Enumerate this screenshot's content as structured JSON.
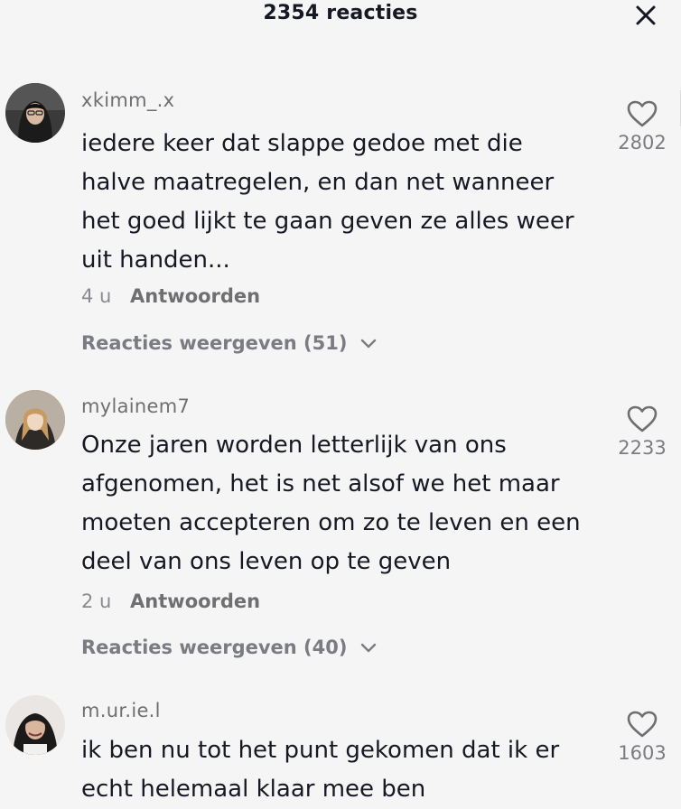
{
  "header": {
    "title": "2354 reacties",
    "close_icon": "close-icon"
  },
  "colors": {
    "background": "#f5f5f5",
    "text_primary": "#161823",
    "text_secondary": "#8a8b91"
  },
  "comments": [
    {
      "username": "xkimm_.x",
      "text": "iedere keer dat slappe gedoe met die halve maatregelen, en dan net wanneer het goed lijkt te gaan geven ze alles weer uit handen...",
      "time": "4 u",
      "reply_label": "Antwoorden",
      "view_replies": "Reacties weergeven (51)",
      "likes": "2802",
      "avatar_icon": "avatar"
    },
    {
      "username": "mylainem7",
      "text": "Onze jaren worden letterlijk van ons afgenomen, het is net alsof we het maar moeten accepteren om zo te leven en een deel van ons leven op te geven",
      "time": "2 u",
      "reply_label": "Antwoorden",
      "view_replies": "Reacties weergeven (40)",
      "likes": "2233",
      "avatar_icon": "avatar"
    },
    {
      "username": "m.ur.ie.l",
      "text": "ik ben nu tot het punt gekomen dat ik er echt helemaal klaar mee ben",
      "likes": "1603",
      "avatar_icon": "avatar"
    }
  ]
}
